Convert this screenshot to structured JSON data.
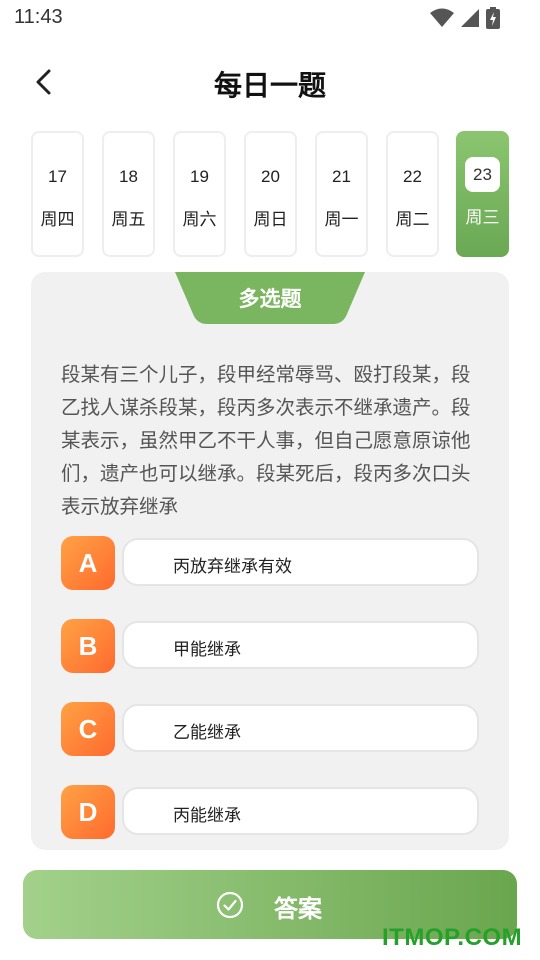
{
  "status_bar": {
    "time": "11:43"
  },
  "header": {
    "title": "每日一题"
  },
  "dates": [
    {
      "day": "17",
      "weekday": "周四",
      "active": false
    },
    {
      "day": "18",
      "weekday": "周五",
      "active": false
    },
    {
      "day": "19",
      "weekday": "周六",
      "active": false
    },
    {
      "day": "20",
      "weekday": "周日",
      "active": false
    },
    {
      "day": "21",
      "weekday": "周一",
      "active": false
    },
    {
      "day": "22",
      "weekday": "周二",
      "active": false
    },
    {
      "day": "23",
      "weekday": "周三",
      "active": true
    }
  ],
  "question_card": {
    "type_label": "多选题",
    "question_text": "段某有三个儿子，段甲经常辱骂、殴打段某，段乙找人谋杀段某，段丙多次表示不继承遗产。段某表示，虽然甲乙不干人事，但自己愿意原谅他们，遗产也可以继承。段某死后，段丙多次口头表示放弃继承",
    "options": [
      {
        "letter": "A",
        "text": "丙放弃继承有效"
      },
      {
        "letter": "B",
        "text": "甲能继承"
      },
      {
        "letter": "C",
        "text": "乙能继承"
      },
      {
        "letter": "D",
        "text": "丙能继承"
      }
    ]
  },
  "answer_button": {
    "label": "答案",
    "icon": "check-circle-icon"
  },
  "watermark": {
    "text": "ITMOP.COM"
  },
  "colors": {
    "accent_green": "#7ab65f",
    "option_orange": "#ff8a3a"
  }
}
